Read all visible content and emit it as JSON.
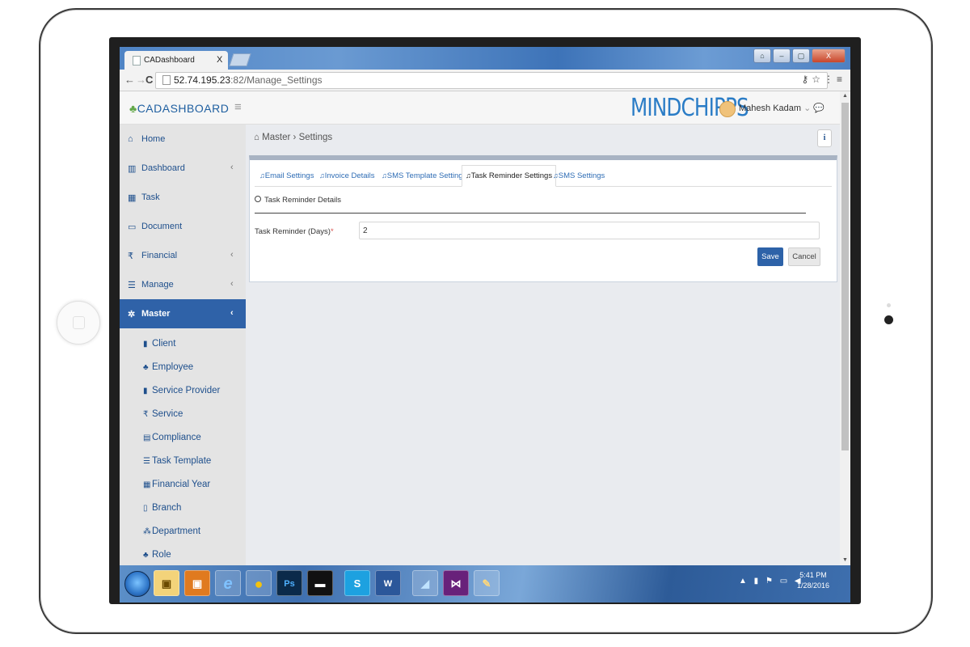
{
  "browser": {
    "tab_title": "CADashboard",
    "tab_close": "X",
    "url_host": "52.74.195.23",
    "url_path": ":82/Manage_Settings",
    "back": "←",
    "forward": "→",
    "reload": "C",
    "window_buttons": [
      "⌂",
      "–",
      "▢",
      "X"
    ]
  },
  "app": {
    "brand": "CADASHBOARD",
    "logo": "MINDCHIPPS",
    "user": "Mahesh Kadam",
    "user_caret": "⌄"
  },
  "sidebar": {
    "items": [
      {
        "label": "Home",
        "icon": "home-icon",
        "glyph": "⌂",
        "arrow": ""
      },
      {
        "label": "Dashboard",
        "icon": "bar-chart-icon",
        "glyph": "▥",
        "arrow": "‹"
      },
      {
        "label": "Task",
        "icon": "calendar-icon",
        "glyph": "▦",
        "arrow": ""
      },
      {
        "label": "Document",
        "icon": "folder-icon",
        "glyph": "▭",
        "arrow": ""
      },
      {
        "label": "Financial",
        "icon": "rupee-icon",
        "glyph": "₹",
        "arrow": "‹"
      },
      {
        "label": "Manage",
        "icon": "list-icon",
        "glyph": "☰",
        "arrow": "‹"
      },
      {
        "label": "Master",
        "icon": "gear-icon",
        "glyph": "✲",
        "arrow": "‹"
      }
    ],
    "sub_items": [
      {
        "label": "Client",
        "glyph": "▮"
      },
      {
        "label": "Employee",
        "glyph": "♣"
      },
      {
        "label": "Service Provider",
        "glyph": "▮"
      },
      {
        "label": "Service",
        "glyph": "₹"
      },
      {
        "label": "Compliance",
        "glyph": "▤"
      },
      {
        "label": "Task Template",
        "glyph": "☰"
      },
      {
        "label": "Financial Year",
        "glyph": "▦"
      },
      {
        "label": "Branch",
        "glyph": "▯"
      },
      {
        "label": "Department",
        "glyph": "⁂"
      },
      {
        "label": "Role",
        "glyph": "♣"
      }
    ]
  },
  "breadcrumb": {
    "home": "Master",
    "sep": "›",
    "current": "Settings"
  },
  "info_label": "i",
  "tabs": [
    {
      "label": "Email Settings"
    },
    {
      "label": "Invoice Details"
    },
    {
      "label": "SMS Template Settings"
    },
    {
      "label": "Task Reminder Settings"
    },
    {
      "label": "SMS Settings"
    }
  ],
  "section_title": "Task Reminder Details",
  "form": {
    "label": "Task Reminder (Days)",
    "required": "*",
    "value": "2",
    "save": "Save",
    "cancel": "Cancel"
  },
  "taskbar": {
    "icons": [
      "",
      "▣",
      "e",
      "●",
      "Ps",
      "▬",
      "S",
      "W",
      "◢",
      "⋈",
      "✎"
    ],
    "time": "5:41 PM",
    "date": "1/28/2016"
  },
  "colors": {
    "accent": "#2f62a8",
    "link": "#2f6db5",
    "required": "#d9534f"
  }
}
